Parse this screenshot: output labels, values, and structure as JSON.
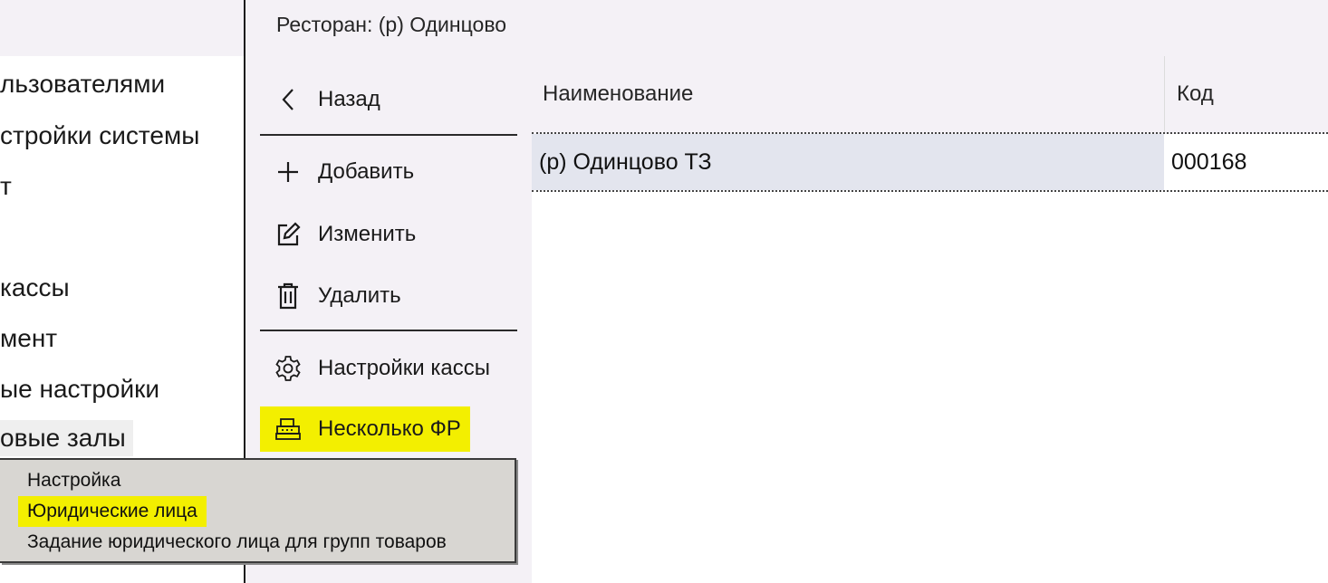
{
  "left_nav": {
    "items": [
      {
        "label": "льзователями"
      },
      {
        "label": "стройки системы"
      },
      {
        "label": "т"
      },
      {
        "label": "кассы"
      },
      {
        "label": "мент"
      },
      {
        "label": "ые настройки"
      },
      {
        "label": "овые залы"
      }
    ]
  },
  "restaurant": {
    "title": "Ресторан: (р) Одинцово"
  },
  "commands": {
    "back": "Назад",
    "add": "Добавить",
    "edit": "Изменить",
    "delete": "Удалить",
    "register_settings": "Настройки кассы",
    "multiple_fr": "Несколько ФР"
  },
  "table": {
    "columns": [
      "Наименование",
      "Код"
    ],
    "rows": [
      {
        "name": "(р) Одинцово ТЗ",
        "code": "000168"
      }
    ]
  },
  "context_menu": {
    "items": [
      "Настройка",
      "Юридические лица",
      "Задание юридического лица для групп товаров"
    ]
  },
  "colors": {
    "panel_bg": "#f4f1f6",
    "highlight": "#f3ef00",
    "selected_cell": "#e3e5ee",
    "menu_bg": "#d8d6d2"
  },
  "icons": [
    "chevron-left-icon",
    "plus-icon",
    "edit-icon",
    "trash-icon",
    "gear-icon",
    "cash-register-icon"
  ]
}
